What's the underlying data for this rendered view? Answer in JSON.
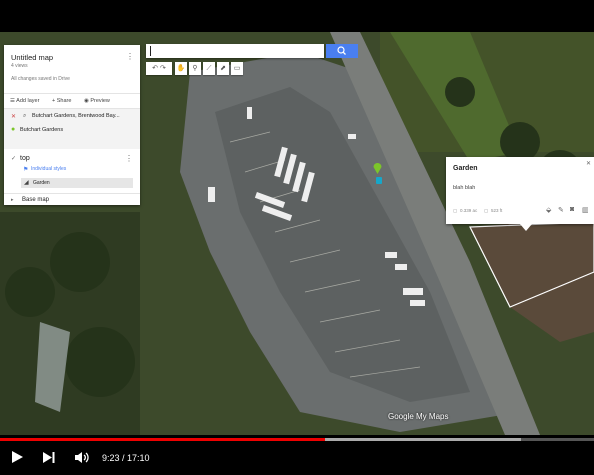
{
  "panel": {
    "map_title": "Untitled map",
    "views": "4 views",
    "saved_status": "All changes saved in Drive",
    "add_layer": "Add layer",
    "share": "Share",
    "preview": "Preview",
    "search_result": "Butchart Gardens, Brentwood Bay...",
    "place_name": "Butchart Gardens",
    "layer_name": "top",
    "layer_style": "Individual styles",
    "feature_name": "Garden",
    "base_map": "Base map"
  },
  "info_window": {
    "name": "Garden",
    "description": "blah blah",
    "area": "0.339 ac",
    "perimeter": "523 ft"
  },
  "branding": {
    "text": "Google My Maps"
  },
  "video": {
    "time_current": "9:23",
    "time_total": "17:10",
    "time_display": "9:23 / 17:10",
    "progress_fraction": 0.547,
    "buffered_fraction": 0.877
  },
  "colors": {
    "progress_played": "#e00000",
    "search_button": "#4a7ff0",
    "place_marker": "#7cc52a",
    "cursor_marker": "#17a7c9"
  },
  "icons": [
    "search-icon",
    "hand-icon",
    "marker-icon",
    "line-icon",
    "route-icon",
    "ruler-icon",
    "menu-icon",
    "play-icon",
    "next-icon",
    "volume-icon",
    "paint-icon",
    "edit-icon",
    "camera-icon",
    "trash-icon",
    "close-icon"
  ]
}
